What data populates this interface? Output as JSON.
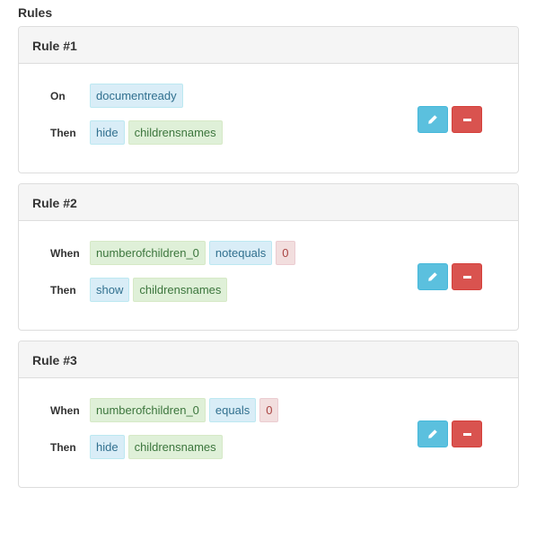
{
  "page": {
    "section_title": "Rules"
  },
  "rules": [
    {
      "title": "Rule #1",
      "rows": [
        {
          "label": "On",
          "tags": [
            {
              "text": "documentready",
              "color": "blue"
            }
          ]
        },
        {
          "label": "Then",
          "tags": [
            {
              "text": "hide",
              "color": "blue"
            },
            {
              "text": "childrensnames",
              "color": "green"
            }
          ]
        }
      ]
    },
    {
      "title": "Rule #2",
      "rows": [
        {
          "label": "When",
          "tags": [
            {
              "text": "numberofchildren_0",
              "color": "green"
            },
            {
              "text": "notequals",
              "color": "blue"
            },
            {
              "text": "0",
              "color": "red"
            }
          ]
        },
        {
          "label": "Then",
          "tags": [
            {
              "text": "show",
              "color": "blue"
            },
            {
              "text": "childrensnames",
              "color": "green"
            }
          ]
        }
      ]
    },
    {
      "title": "Rule #3",
      "rows": [
        {
          "label": "When",
          "tags": [
            {
              "text": "numberofchildren_0",
              "color": "green"
            },
            {
              "text": "equals",
              "color": "blue"
            },
            {
              "text": "0",
              "color": "red"
            }
          ]
        },
        {
          "label": "Then",
          "tags": [
            {
              "text": "hide",
              "color": "blue"
            },
            {
              "text": "childrensnames",
              "color": "green"
            }
          ]
        }
      ]
    }
  ],
  "actions": {
    "edit_icon": "pencil-icon",
    "remove_icon": "minus-icon"
  },
  "colors": {
    "edit_button": "#5bc0de",
    "remove_button": "#d9534f",
    "tag_blue": "#d9edf7",
    "tag_green": "#dff0d8",
    "tag_red": "#f2dede"
  }
}
